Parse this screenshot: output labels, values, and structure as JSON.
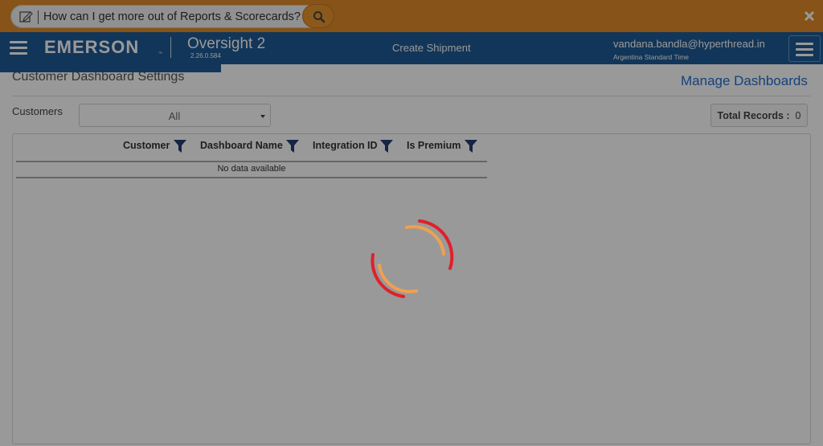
{
  "search": {
    "placeholder": "How can I get more out of Reports & Scorecards?",
    "edit_icon": "edit-icon",
    "search_icon": "search-icon",
    "close_icon": "close-icon"
  },
  "header": {
    "logo": "EMERSON",
    "logo_tm": "™",
    "app_name": "Oversight 2",
    "version": "2.26.0.584",
    "create_shipment": "Create Shipment",
    "user_email": "vandana.bandla@hyperthread.in",
    "user_timezone": "Argentina Standard Time"
  },
  "page": {
    "title": "Customer Dashboard Settings",
    "manage_link": "Manage Dashboards",
    "customers_label": "Customers",
    "customers_selected": "All",
    "total_records_label": "Total Records :",
    "total_records_value": "0"
  },
  "grid": {
    "columns": [
      "Customer",
      "Dashboard Name",
      "Integration ID",
      "Is Premium"
    ],
    "empty_message": "No data available"
  },
  "colors": {
    "banner": "#e28a28",
    "header": "#1f5a95",
    "link": "#1f6fd0",
    "spinner_red": "#e0202a",
    "spinner_orange": "#f0a050"
  }
}
